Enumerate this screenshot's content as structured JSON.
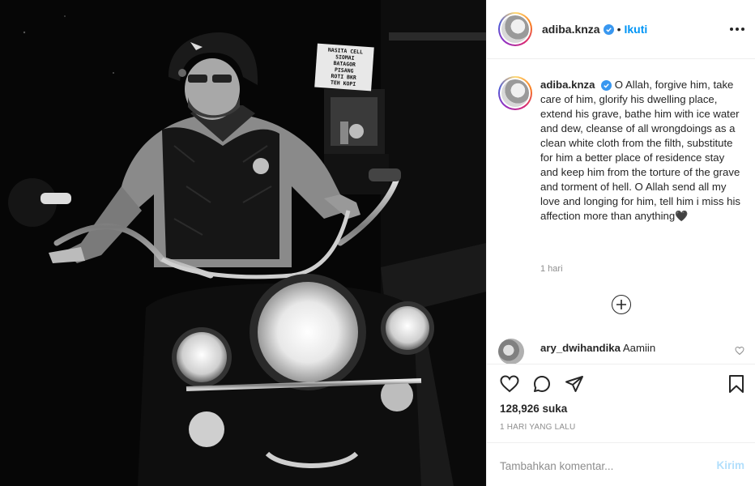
{
  "photo": {
    "sign_text": [
      "NASITA CELL",
      "SIOMAI",
      "BATAGOR",
      "PISANG",
      "ROTI BKR",
      "TEH KOPI"
    ]
  },
  "header": {
    "username": "adiba.knza",
    "separator": "•",
    "follow_label": "Ikuti"
  },
  "caption": {
    "username": "adiba.knza",
    "text": "O Allah, forgive him, take care of him, glorify his dwelling place, extend his grave, bathe him with ice water and dew, cleanse of all wrongdoings as a clean white cloth from the filth, substitute for him a better place of residence stay and keep him from the torture of the grave and torment of hell. O Allah send all my love and longing for him, tell him i miss his affection more than anything",
    "emoji": "🖤",
    "time": "1 hari"
  },
  "comments": [
    {
      "username": "ary_dwihandika",
      "text": "Aamiin"
    }
  ],
  "actions": {
    "likes": "128,926 suka",
    "date": "1 HARI YANG LALU"
  },
  "add_comment": {
    "placeholder": "Tambahkan komentar...",
    "post_label": "Kirim"
  },
  "colors": {
    "link_blue": "#0095f6",
    "verified_blue": "#3897f0",
    "post_disabled": "#b2dffc",
    "text": "#262626",
    "muted": "#8e8e8e"
  }
}
